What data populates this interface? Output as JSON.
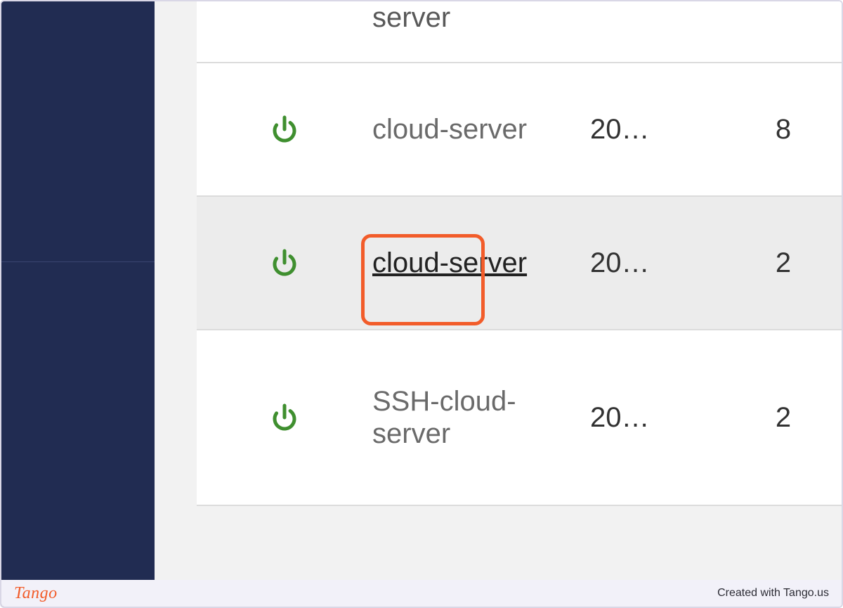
{
  "rows": [
    {
      "name": "server",
      "val1": "",
      "val2": "",
      "partial": "top"
    },
    {
      "name": "cloud-server",
      "val1": "20…",
      "val2": "8"
    },
    {
      "name": "cloud-server",
      "val1": "20…",
      "val2": "2",
      "selected": true,
      "highlighted": true
    },
    {
      "name": "SSH-cloud-server",
      "val1": "20…",
      "val2": "2"
    }
  ],
  "footer": {
    "logo": "Tango",
    "credit": "Created with Tango.us"
  },
  "colors": {
    "sidebar": "#212c52",
    "highlight": "#f25c2a",
    "power_icon": "#3f8f2f"
  }
}
